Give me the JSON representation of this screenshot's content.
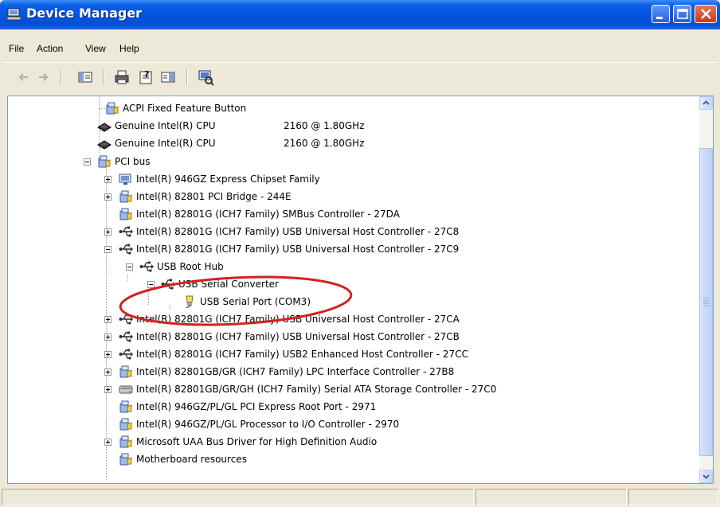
{
  "window": {
    "title": "Device Manager",
    "accent": "#0454e0"
  },
  "menu": {
    "items": [
      {
        "label": "File"
      },
      {
        "label": "Action"
      },
      {
        "label": "View"
      },
      {
        "label": "Help"
      }
    ]
  },
  "toolbar": {
    "buttons": [
      "back-arrow-icon",
      "forward-arrow-icon",
      "show-hide-console-tree-icon",
      "print-icon",
      "properties-icon",
      "help-icon",
      "scan-hardware-icon"
    ]
  },
  "tree": {
    "rows": [
      {
        "label": "ACPI Fixed Feature Button",
        "icon": "system-device-icon"
      },
      {
        "label": "Genuine Intel(R) CPU",
        "detail": "2160 @ 1.80GHz",
        "icon": "processor-icon"
      },
      {
        "label": "Genuine Intel(R) CPU",
        "detail": "2160 @ 1.80GHz",
        "icon": "processor-icon"
      },
      {
        "label": "PCI bus",
        "icon": "system-device-icon",
        "expanded": true
      },
      {
        "label": "Intel(R)  946GZ Express Chipset Family",
        "icon": "display-adapter-icon",
        "expanded": false
      },
      {
        "label": "Intel(R) 82801 PCI Bridge - 244E",
        "icon": "system-device-icon",
        "expanded": false
      },
      {
        "label": "Intel(R) 82801G (ICH7 Family) SMBus Controller - 27DA",
        "icon": "system-device-icon"
      },
      {
        "label": "Intel(R) 82801G (ICH7 Family) USB Universal Host Controller - 27C8",
        "icon": "usb-icon",
        "expanded": false
      },
      {
        "label": "Intel(R) 82801G (ICH7 Family) USB Universal Host Controller - 27C9",
        "icon": "usb-icon",
        "expanded": true
      },
      {
        "label": "USB Root Hub",
        "icon": "usb-icon",
        "expanded": true
      },
      {
        "label": "USB Serial Converter",
        "icon": "usb-icon",
        "expanded": true
      },
      {
        "label": "USB Serial Port (COM3)",
        "icon": "port-icon"
      },
      {
        "label": "Intel(R) 82801G (ICH7 Family) USB Universal Host Controller - 27CA",
        "icon": "usb-icon",
        "expanded": false
      },
      {
        "label": "Intel(R) 82801G (ICH7 Family) USB Universal Host Controller - 27CB",
        "icon": "usb-icon",
        "expanded": false
      },
      {
        "label": "Intel(R) 82801G (ICH7 Family) USB2 Enhanced Host Controller - 27CC",
        "icon": "usb-icon",
        "expanded": false
      },
      {
        "label": "Intel(R) 82801GB/GR (ICH7 Family) LPC Interface Controller - 27B8",
        "icon": "system-device-icon",
        "expanded": false
      },
      {
        "label": "Intel(R) 82801GB/GR/GH (ICH7 Family) Serial ATA Storage Controller - 27C0",
        "icon": "storage-controller-icon",
        "expanded": false
      },
      {
        "label": "Intel(R) 946GZ/PL/GL PCI Express Root Port - 2971",
        "icon": "system-device-icon"
      },
      {
        "label": "Intel(R) 946GZ/PL/GL Processor to I/O Controller - 2970",
        "icon": "system-device-icon"
      },
      {
        "label": "Microsoft UAA Bus Driver for High Definition Audio",
        "icon": "system-device-icon",
        "expanded": false
      },
      {
        "label": "Motherboard resources",
        "icon": "system-device-icon"
      }
    ]
  },
  "annotation": {
    "color": "#d42020"
  }
}
